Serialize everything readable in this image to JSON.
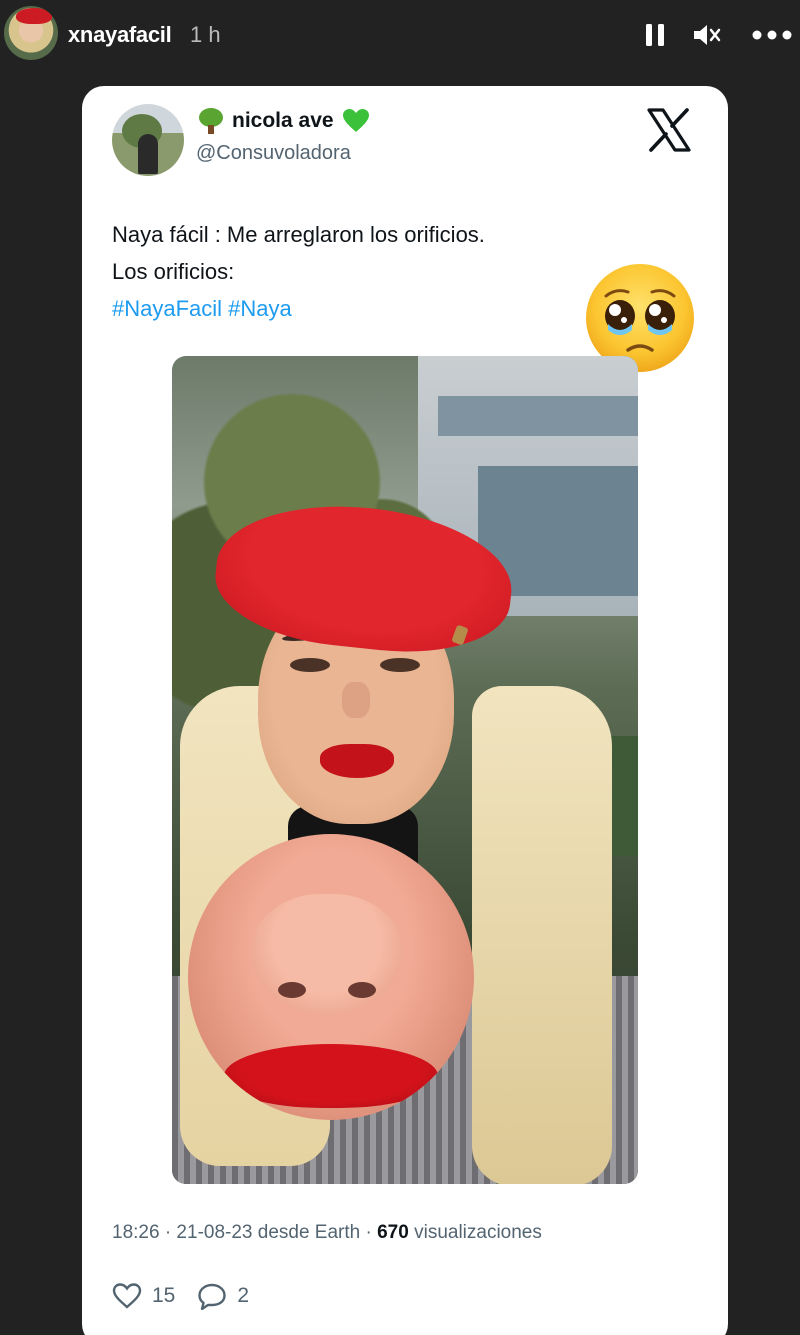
{
  "story": {
    "username": "xnayafacil",
    "time_ago": "1 h",
    "controls": [
      "pause-icon",
      "mute-icon",
      "more-icon"
    ]
  },
  "tweet": {
    "author_name": "nicola ave",
    "author_handle": "@Consuvoladora",
    "name_emojis": [
      "tree-emoji",
      "green-heart-emoji"
    ],
    "platform_logo": "x-logo",
    "text_line1": "Naya fácil : Me arreglaron los orificios.",
    "text_line2": "Los orificios:",
    "hashtags": [
      "#NayaFacil",
      "#Naya"
    ],
    "sticker": "pleading-face-emoji",
    "meta_prefix": "18:26 · 21-08-23 desde Earth · ",
    "views_count": "670",
    "views_label": " visualizaciones",
    "likes": "15",
    "replies": "2"
  },
  "colors": {
    "story_bg": "#222222",
    "card_bg": "#ffffff",
    "hashtag": "#1d9bf0",
    "secondary_text": "#536471"
  }
}
